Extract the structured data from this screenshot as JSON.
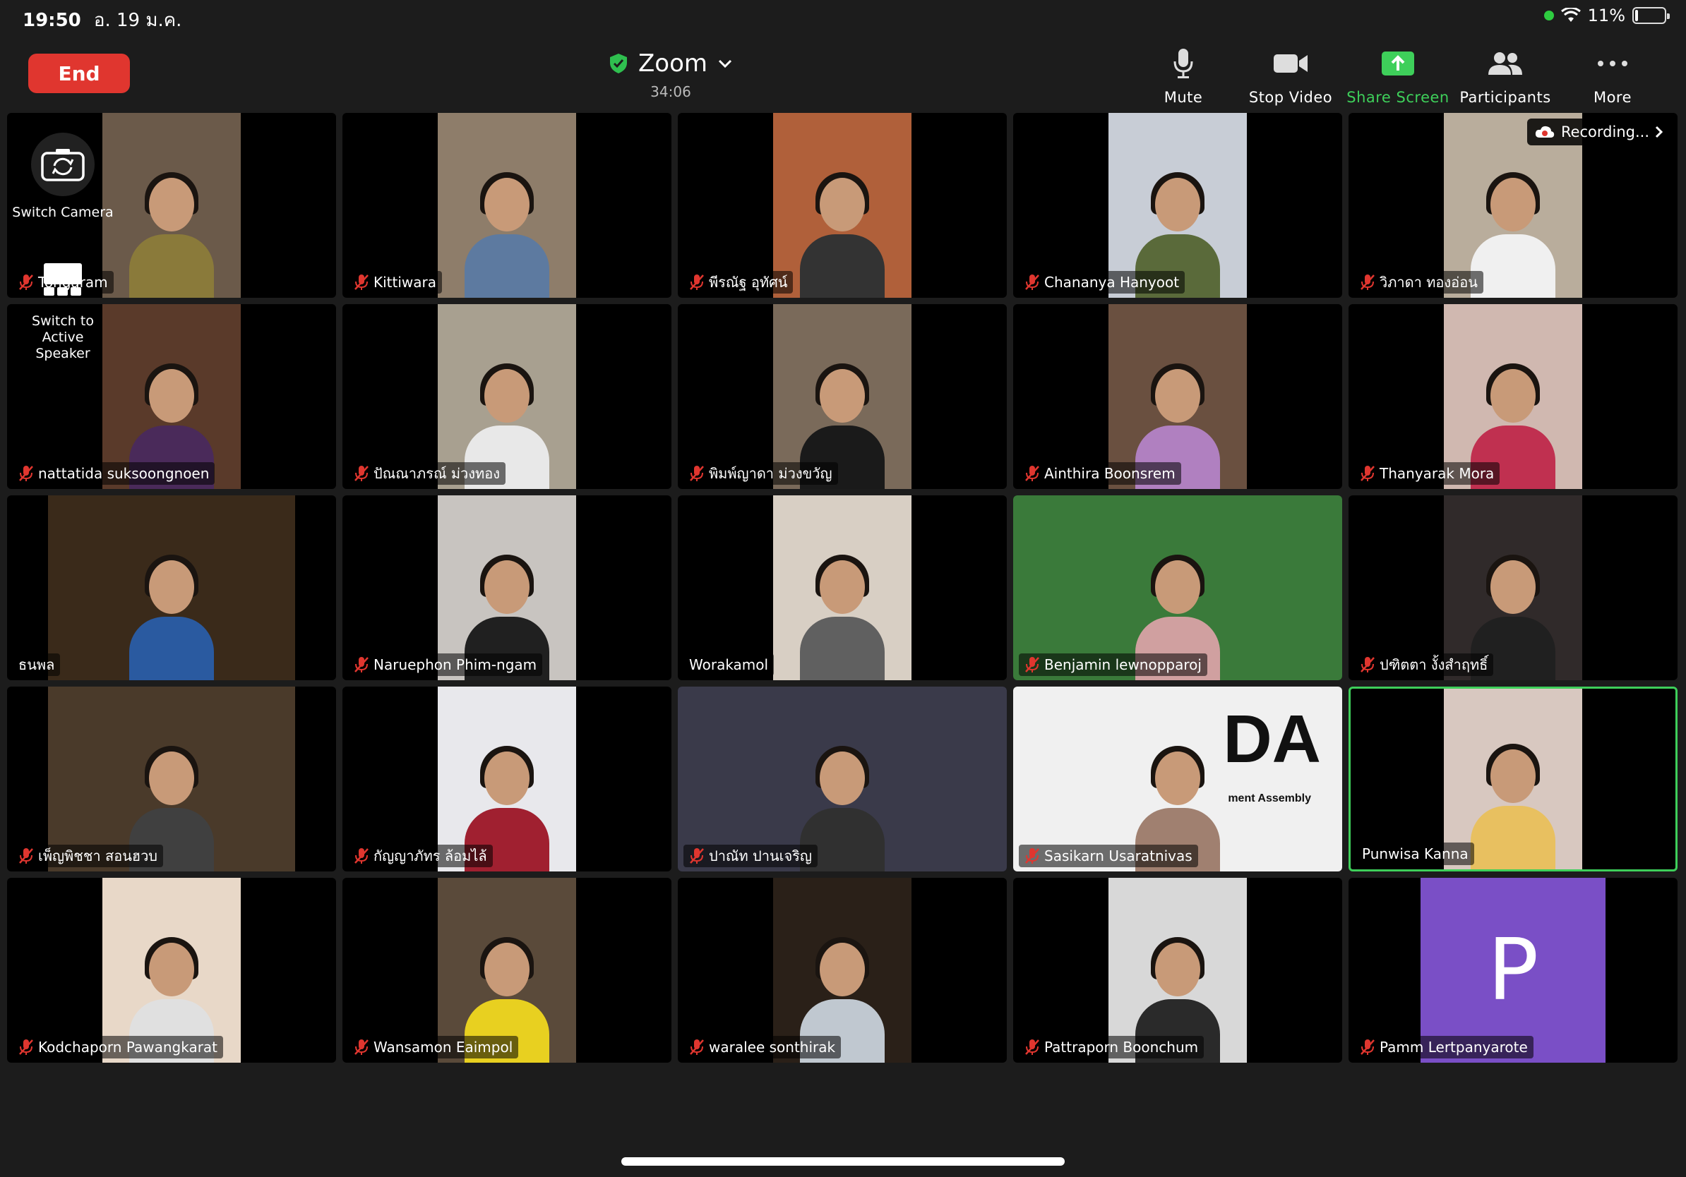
{
  "status_bar": {
    "time": "19:50",
    "date": "อ. 19 ม.ค.",
    "battery": "11%",
    "battery_level": 0.11
  },
  "toolbar": {
    "end_label": "End",
    "meeting_title": "Zoom",
    "timer": "34:06",
    "tools": [
      {
        "label": "Mute",
        "icon": "microphone-icon"
      },
      {
        "label": "Stop Video",
        "icon": "video-camera-icon"
      },
      {
        "label": "Share Screen",
        "icon": "share-screen-icon"
      },
      {
        "label": "Participants",
        "icon": "participants-icon"
      },
      {
        "label": "More",
        "icon": "more-icon"
      }
    ]
  },
  "overlay": {
    "switch_camera": "Switch Camera",
    "switch_active_speaker": "Switch to Active Speaker"
  },
  "recording_label": "Recording...",
  "participants": [
    {
      "name": "Tongaram",
      "muted": true,
      "bg": "#6b5a4a",
      "shirt": "#8a7a3a"
    },
    {
      "name": "Kittiwara",
      "muted": true,
      "bg": "#8e7d6a",
      "shirt": "#5d7aa0"
    },
    {
      "name": "พีรณัฐ อุทัศน์",
      "muted": true,
      "bg": "#b0603a",
      "shirt": "#333333"
    },
    {
      "name": "Chananya Hanyoot",
      "muted": true,
      "bg": "#c8cdd6",
      "shirt": "#5a6a3a"
    },
    {
      "name": "วิภาดา ทองอ่อน",
      "muted": true,
      "bg": "#b9ad9c",
      "shirt": "#f0f0f0"
    },
    {
      "name": "nattatida suksoongnoen",
      "muted": true,
      "bg": "#5a3a2a",
      "shirt": "#4a2a5a"
    },
    {
      "name": "ปัณณาภรณ์ ม่วงทอง",
      "muted": true,
      "bg": "#a8a090",
      "shirt": "#e8e8e8"
    },
    {
      "name": "พิมพ์ญาดา ม่วงขวัญ",
      "muted": true,
      "bg": "#7a6a5a",
      "shirt": "#1a1a1a"
    },
    {
      "name": "Ainthira Boonsrem",
      "muted": true,
      "bg": "#6a5040",
      "shirt": "#b080c0"
    },
    {
      "name": "Thanyarak Mora",
      "muted": true,
      "bg": "#d0b8b0",
      "shirt": "#c03050"
    },
    {
      "name": "ธนพล",
      "muted": false,
      "bg": "#3a2a1a",
      "shirt": "#2a5aa0"
    },
    {
      "name": "Naruephon Phim-ngam",
      "muted": true,
      "bg": "#c8c4c0",
      "shirt": "#202020"
    },
    {
      "name": "Worakamol",
      "muted": false,
      "bg": "#d8cfc4",
      "shirt": "#606060"
    },
    {
      "name": "Benjamin lewnopparoj",
      "muted": true,
      "bg": "#3a7a3a",
      "shirt": "#d0a0a0"
    },
    {
      "name": "ปฑิตตา งั้งสำฤทธิ์",
      "muted": true,
      "bg": "#302a2a",
      "shirt": "#202020"
    },
    {
      "name": "เพ็ญพิชชา สอนฮวบ",
      "muted": true,
      "bg": "#4a3a2a",
      "shirt": "#404040"
    },
    {
      "name": "กัญญาภัทร ล้อมไล้",
      "muted": true,
      "bg": "#e8e8ec",
      "shirt": "#a02030"
    },
    {
      "name": "ปาณัท ปานเจริญ",
      "muted": true,
      "bg": "#3a3a4a",
      "shirt": "#303030"
    },
    {
      "name": "Sasikarn Usaratnivas",
      "muted": true,
      "bg": "#f0f0f0",
      "shirt": "#a08070",
      "overlay_text": "DA",
      "overlay_sub": "ment Assembly"
    },
    {
      "name": "Punwisa Kanna",
      "muted": false,
      "bg": "#d8c8c0",
      "shirt": "#e8c060"
    },
    {
      "name": "Kodchaporn Pawangkarat",
      "muted": true,
      "bg": "#e8d8c8",
      "shirt": "#e0e0e0"
    },
    {
      "name": "Wansamon Eaimpol",
      "muted": true,
      "bg": "#5a4a3a",
      "shirt": "#e8d020"
    },
    {
      "name": "waralee sonthirak",
      "muted": true,
      "bg": "#2a2018",
      "shirt": "#c0c8d0"
    },
    {
      "name": "Pattraporn Boonchum",
      "muted": true,
      "bg": "#d8d8d8",
      "shirt": "#2a2a2a"
    },
    {
      "name": "Pamm Lertpanyarote",
      "muted": true,
      "avatar_letter": "P",
      "avatar_color": "#7a4fc6"
    }
  ],
  "colors": {
    "end": "#e0362f",
    "accent_green": "#3ecf5a",
    "mic_muted": "#e0362f"
  }
}
